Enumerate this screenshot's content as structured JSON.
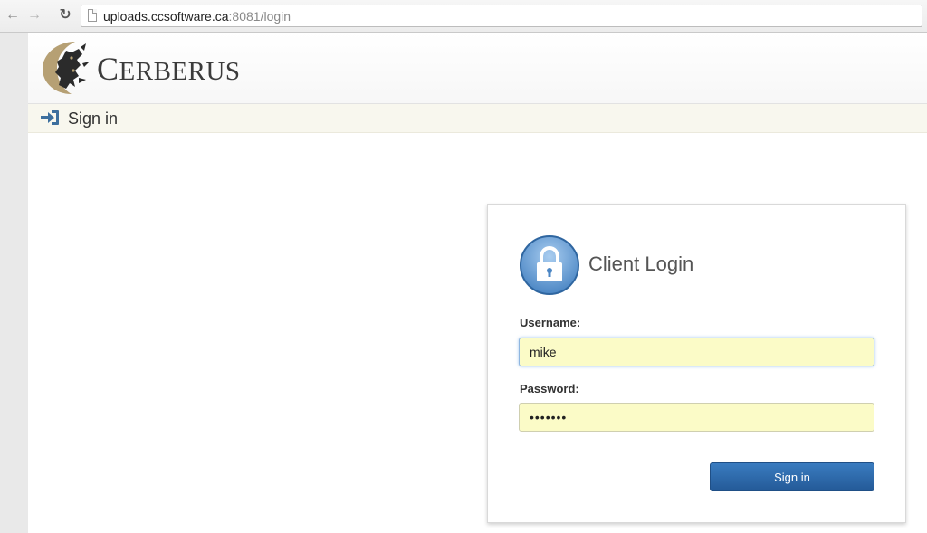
{
  "browser": {
    "url_host": "uploads.ccsoftware.ca",
    "url_rest": ":8081/login"
  },
  "header": {
    "brand_first": "C",
    "brand_rest": "ERBERUS",
    "logo_icon": "cerberus-three-headed-dog-logo"
  },
  "breadcrumb": {
    "icon": "sign-in-arrow-icon",
    "label": "Sign in"
  },
  "login": {
    "icon": "padlock-icon",
    "title": "Client Login",
    "username_label": "Username:",
    "username_value": "mike",
    "password_label": "Password:",
    "password_value": "•••••••",
    "submit_label": "Sign in"
  },
  "colors": {
    "accent_blue": "#2f6aa8",
    "input_autofill": "#fbfbc7",
    "breadcrumb_bg": "#f8f7ee",
    "logo_gold": "#b6a074"
  }
}
